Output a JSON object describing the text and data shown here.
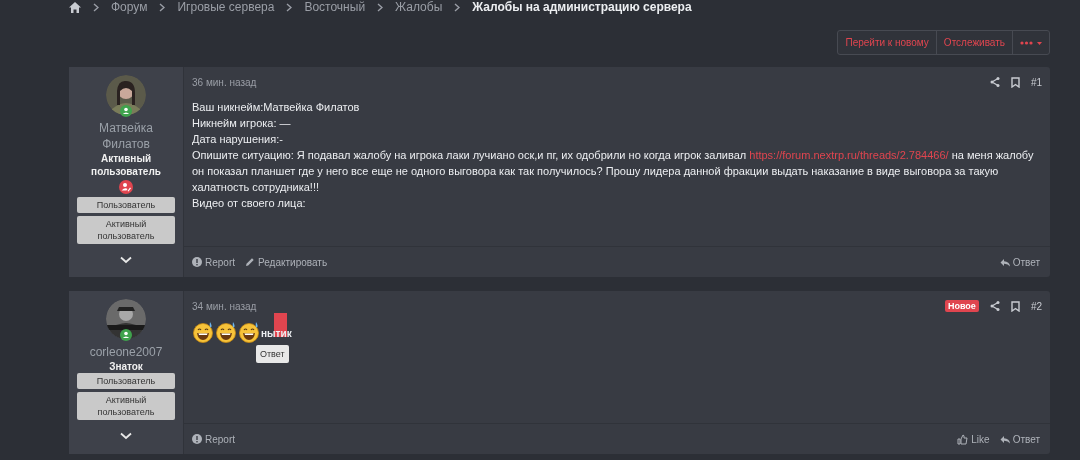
{
  "breadcrumb": [
    {
      "label": "Форум",
      "current": false
    },
    {
      "label": "Игровые сервера",
      "current": false
    },
    {
      "label": "Восточный",
      "current": false
    },
    {
      "label": "Жалобы",
      "current": false
    },
    {
      "label": "Жалобы на администрацию сервера",
      "current": true
    }
  ],
  "thread_actions": [
    "Перейти к новому",
    "Отслеживать"
  ],
  "posts": [
    {
      "author": {
        "name": "Матвейка Филатов",
        "title": "Активный пользователь",
        "online": true,
        "badge": true,
        "groups": [
          "Пользователь",
          "Активный пользователь"
        ]
      },
      "time": "36 мин. назад",
      "is_new": false,
      "number": "#1",
      "body": [
        {
          "kind": "paragraph",
          "text": "Ваш никнейм:Матвейка Филатов"
        },
        {
          "kind": "paragraph",
          "text": "Никнейм игрока: —"
        },
        {
          "kind": "paragraph",
          "text": "Дата нарушения:-"
        },
        {
          "kind": "linked",
          "before": "Опишите ситуацию: Я подавал жалобу на игрока лаки лучиано оск,и пг, их одобрили но когда игрок заливал ",
          "link": "https://forum.nextrp.ru/threads/2.784466/",
          "after": " на меня жалобу он показал планшет где у него все еще не одного выговора как так получилось? Прошу лидера данной фракции выдать наказание в виде выговора за такую халатность сотрудника!!!"
        },
        {
          "kind": "paragraph",
          "text": "Видео от своего лица:"
        }
      ],
      "actions": [
        {
          "kind": "report",
          "label": "Report"
        },
        {
          "kind": "edit",
          "label": "Редактировать"
        }
      ],
      "right_actions": [
        {
          "kind": "reply",
          "label": "Ответ"
        }
      ]
    },
    {
      "author": {
        "name": "corleone2007",
        "title": "Знаток",
        "online": true,
        "badge": false,
        "groups": [
          "Пользователь",
          "Активный пользователь"
        ]
      },
      "time": "34 мин. назад",
      "is_new": true,
      "new_label": "Новое",
      "number": "#2",
      "body": [
        {
          "kind": "emoji"
        },
        {
          "kind": "emoji"
        },
        {
          "kind": "emoji"
        },
        {
          "kind": "selected_text",
          "text": "нытик",
          "tooltip": "Ответ"
        }
      ],
      "actions": [
        {
          "kind": "report",
          "label": "Report"
        }
      ],
      "right_actions": [
        {
          "kind": "like",
          "label": "Like"
        },
        {
          "kind": "reply",
          "label": "Ответ"
        }
      ]
    }
  ]
}
